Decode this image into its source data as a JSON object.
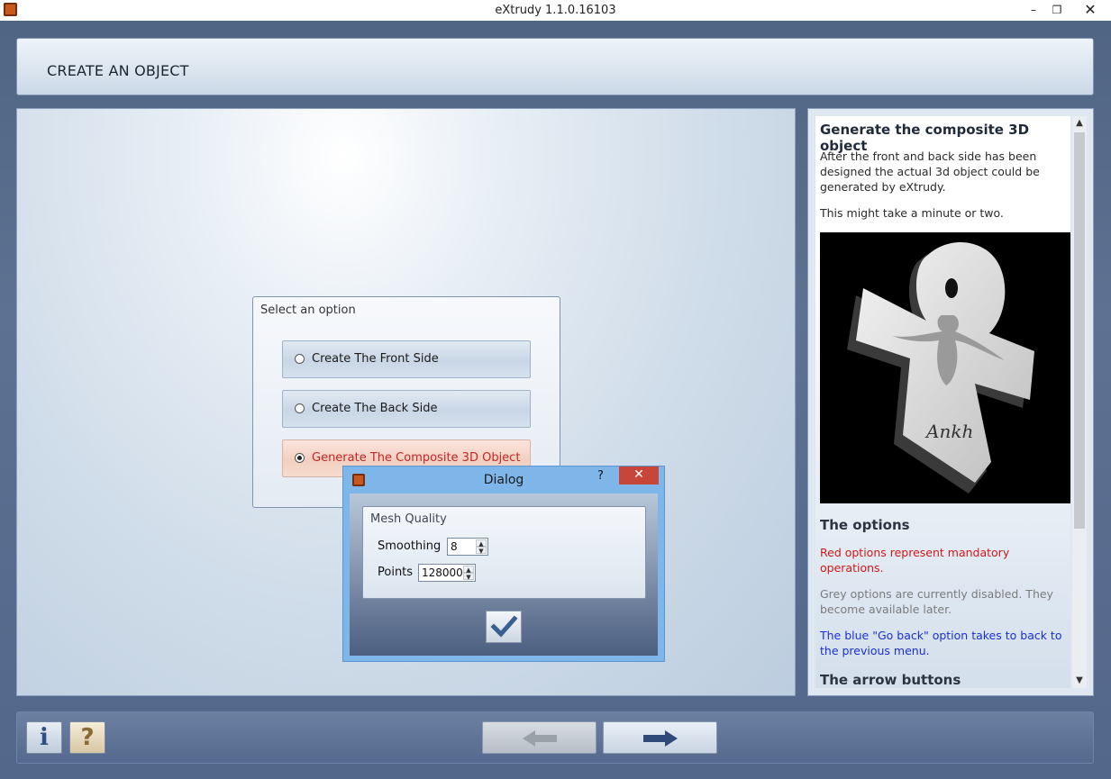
{
  "window": {
    "title": "eXtrudy 1.1.0.16103",
    "minimize_glyph": "–",
    "restore_glyph": "❐",
    "close_glyph": "✕"
  },
  "header": {
    "title": "CREATE AN OBJECT"
  },
  "options": {
    "group_label": "Select an option",
    "items": [
      {
        "label": "Create The Front Side",
        "selected": false
      },
      {
        "label": "Create The Back Side",
        "selected": false
      },
      {
        "label": "Generate The Composite 3D Object",
        "selected": true
      }
    ]
  },
  "dialog": {
    "title": "Dialog",
    "help_glyph": "?",
    "close_glyph": "✕",
    "group_label": "Mesh Quality",
    "smoothing_label": "Smoothing",
    "smoothing_value": "8",
    "points_label": "Points",
    "points_value": "128000"
  },
  "help": {
    "title": "Generate the composite 3D object",
    "para1": "After the front and back side has been designed the actual 3d object could be generated by eXtrudy.",
    "para2": "This might take a minute or two.",
    "options_heading": "The options",
    "red_note": "Red options represent mandatory operations.",
    "grey_note": "Grey options are currently disabled. They become available later.",
    "blue_note": "The blue \"Go back\" option takes to back to the previous menu.",
    "arrows_heading": "The arrow buttons",
    "preview_signature": "Ankh"
  },
  "bottom": {
    "info_glyph": "i",
    "help_glyph": "?"
  },
  "colors": {
    "mandatory": "#d01818",
    "disabled": "#7b7b7b",
    "go_back": "#1a2fd6",
    "dialog_frame": "#7fb6ea",
    "close_red": "#c8453a"
  }
}
